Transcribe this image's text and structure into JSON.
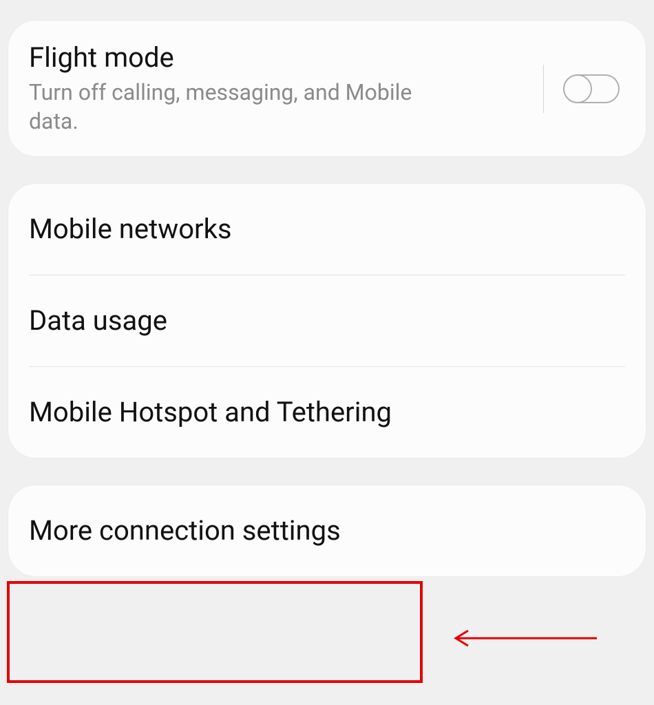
{
  "flight": {
    "title": "Flight mode",
    "subtitle": "Turn off calling, messaging, and Mobile data.",
    "enabled": false
  },
  "group2": {
    "items": [
      {
        "label": "Mobile networks"
      },
      {
        "label": "Data usage"
      },
      {
        "label": "Mobile Hotspot and Tethering"
      }
    ]
  },
  "group3": {
    "items": [
      {
        "label": "More connection settings"
      }
    ]
  }
}
